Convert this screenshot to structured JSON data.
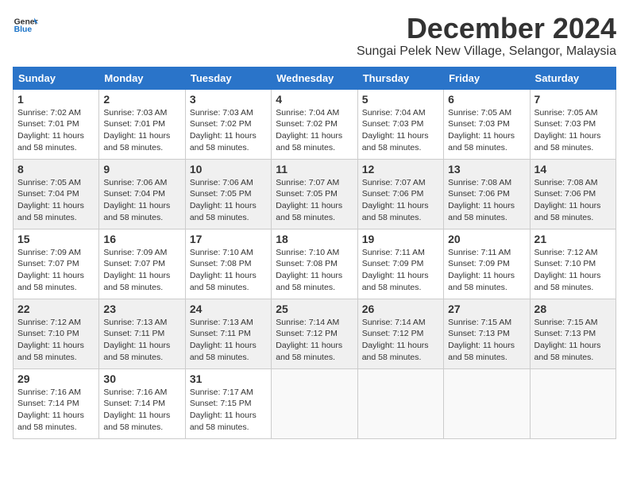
{
  "logo": {
    "line1": "General",
    "line2": "Blue"
  },
  "title": "December 2024",
  "location": "Sungai Pelek New Village, Selangor, Malaysia",
  "days_of_week": [
    "Sunday",
    "Monday",
    "Tuesday",
    "Wednesday",
    "Thursday",
    "Friday",
    "Saturday"
  ],
  "weeks": [
    [
      {
        "day": "1",
        "sunrise": "7:02 AM",
        "sunset": "7:01 PM",
        "daylight": "11 hours and 58 minutes."
      },
      {
        "day": "2",
        "sunrise": "7:03 AM",
        "sunset": "7:01 PM",
        "daylight": "11 hours and 58 minutes."
      },
      {
        "day": "3",
        "sunrise": "7:03 AM",
        "sunset": "7:02 PM",
        "daylight": "11 hours and 58 minutes."
      },
      {
        "day": "4",
        "sunrise": "7:04 AM",
        "sunset": "7:02 PM",
        "daylight": "11 hours and 58 minutes."
      },
      {
        "day": "5",
        "sunrise": "7:04 AM",
        "sunset": "7:03 PM",
        "daylight": "11 hours and 58 minutes."
      },
      {
        "day": "6",
        "sunrise": "7:05 AM",
        "sunset": "7:03 PM",
        "daylight": "11 hours and 58 minutes."
      },
      {
        "day": "7",
        "sunrise": "7:05 AM",
        "sunset": "7:03 PM",
        "daylight": "11 hours and 58 minutes."
      }
    ],
    [
      {
        "day": "8",
        "sunrise": "7:05 AM",
        "sunset": "7:04 PM",
        "daylight": "11 hours and 58 minutes."
      },
      {
        "day": "9",
        "sunrise": "7:06 AM",
        "sunset": "7:04 PM",
        "daylight": "11 hours and 58 minutes."
      },
      {
        "day": "10",
        "sunrise": "7:06 AM",
        "sunset": "7:05 PM",
        "daylight": "11 hours and 58 minutes."
      },
      {
        "day": "11",
        "sunrise": "7:07 AM",
        "sunset": "7:05 PM",
        "daylight": "11 hours and 58 minutes."
      },
      {
        "day": "12",
        "sunrise": "7:07 AM",
        "sunset": "7:06 PM",
        "daylight": "11 hours and 58 minutes."
      },
      {
        "day": "13",
        "sunrise": "7:08 AM",
        "sunset": "7:06 PM",
        "daylight": "11 hours and 58 minutes."
      },
      {
        "day": "14",
        "sunrise": "7:08 AM",
        "sunset": "7:06 PM",
        "daylight": "11 hours and 58 minutes."
      }
    ],
    [
      {
        "day": "15",
        "sunrise": "7:09 AM",
        "sunset": "7:07 PM",
        "daylight": "11 hours and 58 minutes."
      },
      {
        "day": "16",
        "sunrise": "7:09 AM",
        "sunset": "7:07 PM",
        "daylight": "11 hours and 58 minutes."
      },
      {
        "day": "17",
        "sunrise": "7:10 AM",
        "sunset": "7:08 PM",
        "daylight": "11 hours and 58 minutes."
      },
      {
        "day": "18",
        "sunrise": "7:10 AM",
        "sunset": "7:08 PM",
        "daylight": "11 hours and 58 minutes."
      },
      {
        "day": "19",
        "sunrise": "7:11 AM",
        "sunset": "7:09 PM",
        "daylight": "11 hours and 58 minutes."
      },
      {
        "day": "20",
        "sunrise": "7:11 AM",
        "sunset": "7:09 PM",
        "daylight": "11 hours and 58 minutes."
      },
      {
        "day": "21",
        "sunrise": "7:12 AM",
        "sunset": "7:10 PM",
        "daylight": "11 hours and 58 minutes."
      }
    ],
    [
      {
        "day": "22",
        "sunrise": "7:12 AM",
        "sunset": "7:10 PM",
        "daylight": "11 hours and 58 minutes."
      },
      {
        "day": "23",
        "sunrise": "7:13 AM",
        "sunset": "7:11 PM",
        "daylight": "11 hours and 58 minutes."
      },
      {
        "day": "24",
        "sunrise": "7:13 AM",
        "sunset": "7:11 PM",
        "daylight": "11 hours and 58 minutes."
      },
      {
        "day": "25",
        "sunrise": "7:14 AM",
        "sunset": "7:12 PM",
        "daylight": "11 hours and 58 minutes."
      },
      {
        "day": "26",
        "sunrise": "7:14 AM",
        "sunset": "7:12 PM",
        "daylight": "11 hours and 58 minutes."
      },
      {
        "day": "27",
        "sunrise": "7:15 AM",
        "sunset": "7:13 PM",
        "daylight": "11 hours and 58 minutes."
      },
      {
        "day": "28",
        "sunrise": "7:15 AM",
        "sunset": "7:13 PM",
        "daylight": "11 hours and 58 minutes."
      }
    ],
    [
      {
        "day": "29",
        "sunrise": "7:16 AM",
        "sunset": "7:14 PM",
        "daylight": "11 hours and 58 minutes."
      },
      {
        "day": "30",
        "sunrise": "7:16 AM",
        "sunset": "7:14 PM",
        "daylight": "11 hours and 58 minutes."
      },
      {
        "day": "31",
        "sunrise": "7:17 AM",
        "sunset": "7:15 PM",
        "daylight": "11 hours and 58 minutes."
      },
      null,
      null,
      null,
      null
    ]
  ],
  "labels": {
    "sunrise": "Sunrise:",
    "sunset": "Sunset:",
    "daylight": "Daylight:"
  }
}
